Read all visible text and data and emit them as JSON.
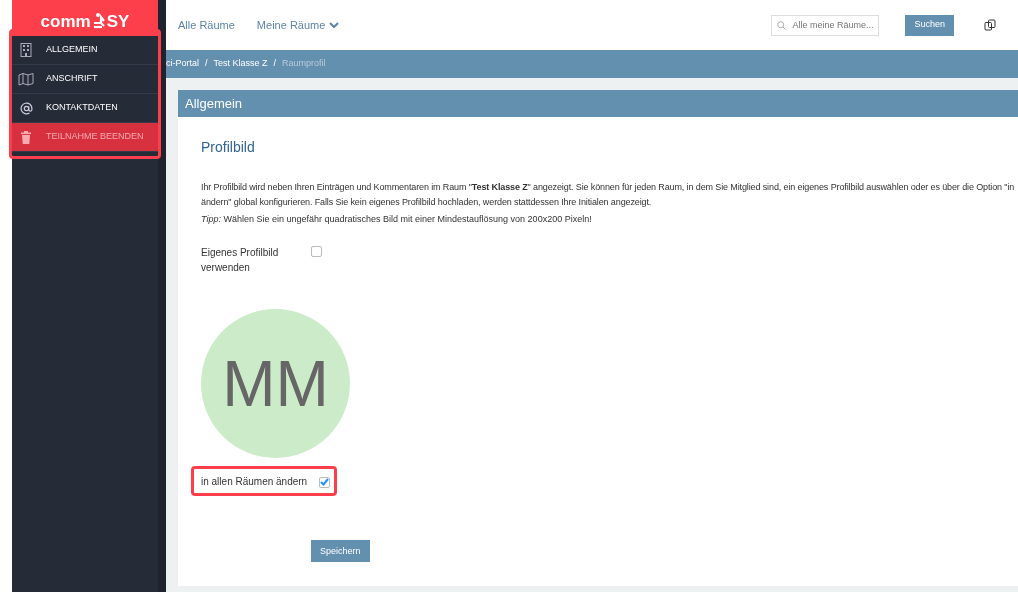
{
  "logo": {
    "left": "comm",
    "right": "SY"
  },
  "sidebar": {
    "highlighted": true,
    "items": [
      {
        "label": "ALLGEMEIN",
        "kind": "normal"
      },
      {
        "label": "ANSCHRIFT",
        "kind": "normal"
      },
      {
        "label": "KONTAKTDATEN",
        "kind": "normal"
      },
      {
        "label": "TEILNAHME BEENDEN",
        "kind": "danger"
      }
    ]
  },
  "topnav": {
    "links": [
      {
        "label": "Alle Räume",
        "dropdown": false
      },
      {
        "label": "Meine Räume",
        "dropdown": true
      }
    ],
    "search": {
      "placeholder": "Alle meine Räume..."
    },
    "search_button": "Suchen"
  },
  "breadcrumb_separator": "/",
  "breadcrumb": [
    {
      "label": "ci-Portal",
      "current": false
    },
    {
      "label": "Test Klasse Z",
      "current": false
    },
    {
      "label": "Raumprofil",
      "current": true
    }
  ],
  "panel": {
    "title": "Allgemein",
    "heading": "Profilbild",
    "paragraph": [
      "Ihr Profilbild wird neben Ihren Einträgen und Kommentaren im Raum \"**Test Klasse Z**\" angezeigt. Sie können für jeden Raum, in dem Sie Mitglied sind, ein eigenes Profilbild auswählen oder es über die Option \"in",
      "ändern\" global konfigurieren. Falls Sie kein eigenes Profilbild hochladen, werden stattdessen Ihre Initialen angezeigt."
    ],
    "tip": "*Tipp:* Wählen Sie ein ungefähr quadratisches Bild mit einer Mindestauflösung von 200x200 Pixeln!",
    "own_picture": {
      "label": "Eigenes Profilbild verwenden",
      "checked": false
    },
    "avatar": {
      "initials": "MM",
      "color": "#ccebc8"
    },
    "all_rooms": {
      "label": "in allen Räumen ändern",
      "checked": true,
      "highlighted": true
    },
    "save_button": "Speichern"
  }
}
